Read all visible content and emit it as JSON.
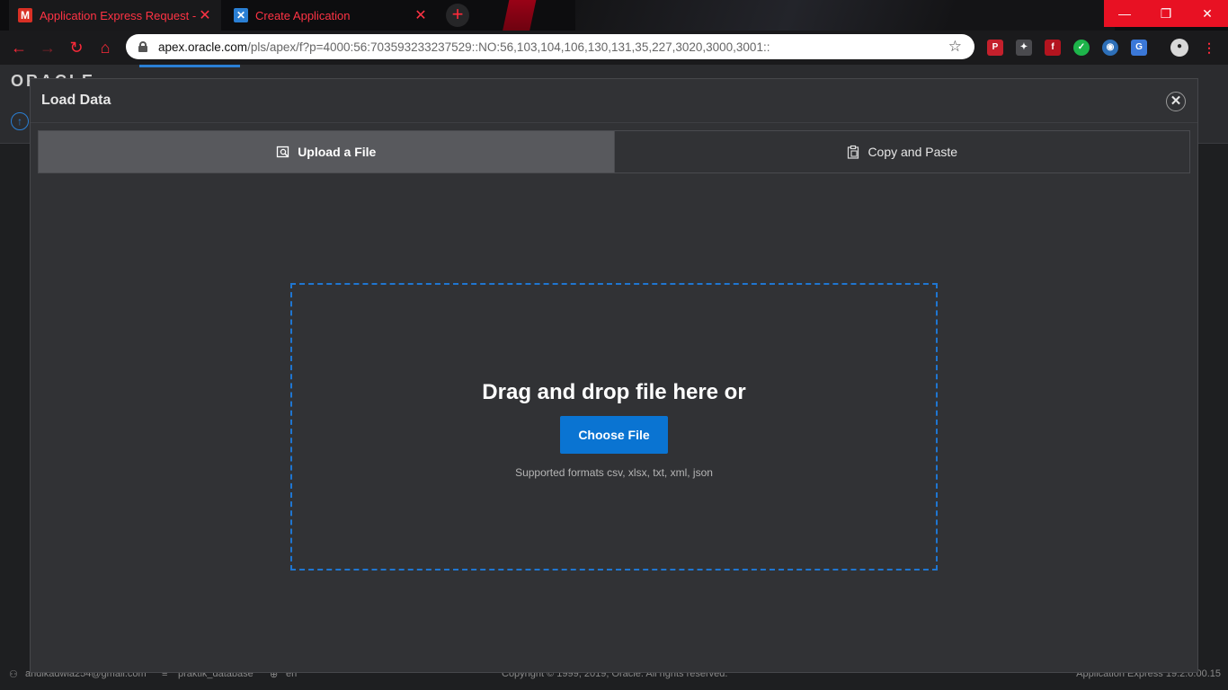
{
  "browser": {
    "tabs": [
      {
        "label": "Application Express Request - an",
        "icon": "gmail-icon"
      },
      {
        "label": "Create Application",
        "icon": "apex-icon"
      }
    ],
    "new_tab_label": "+",
    "url_host": "apex.oracle.com",
    "url_path": "/pls/apex/f?p=4000:56:703593233237529::NO:56,103,104,106,130,131,35,227,3020,3000,3001::",
    "window_controls": {
      "minimize": "—",
      "restore": "❐",
      "close": "✕"
    }
  },
  "app": {
    "logo": "ORACLE"
  },
  "dialog": {
    "title": "Load Data",
    "close_label": "✕",
    "tabs": [
      {
        "label": "Upload a File",
        "active": true
      },
      {
        "label": "Copy and Paste",
        "active": false
      }
    ],
    "dropzone": {
      "heading": "Drag and drop file here or",
      "button_label": "Choose File",
      "formats": "Supported formats csv, xlsx, txt, xml, json"
    }
  },
  "footer": {
    "user": "andikadwia254@gmail.com",
    "workspace": "praktik_database",
    "language": "en",
    "copyright": "Copyright © 1999, 2019, Oracle. All rights reserved.",
    "version": "Application Express 19.2.0.00.15"
  },
  "colors": {
    "accent": "#0a74d2",
    "dropzone_border": "#1f76d1",
    "browser_accent": "#ff2a3a"
  }
}
